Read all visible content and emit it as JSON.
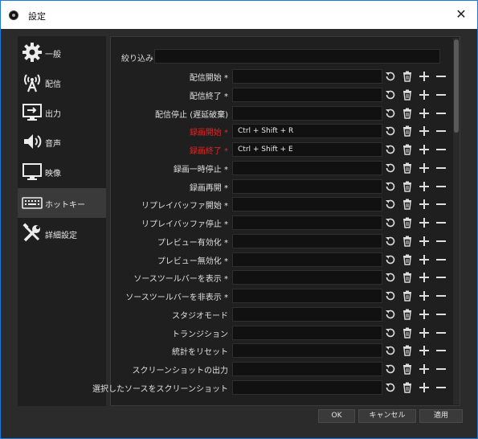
{
  "window": {
    "title": "設定",
    "close_glyph": "✕"
  },
  "sidebar": {
    "items": [
      {
        "label": "一般",
        "icon": "gear-icon",
        "selected": false
      },
      {
        "label": "配信",
        "icon": "broadcast-antenna-icon",
        "selected": false
      },
      {
        "label": "出力",
        "icon": "output-monitor-icon",
        "selected": false
      },
      {
        "label": "音声",
        "icon": "speaker-icon",
        "selected": false
      },
      {
        "label": "映像",
        "icon": "monitor-icon",
        "selected": false
      },
      {
        "label": "ホットキー",
        "icon": "keyboard-icon",
        "selected": true
      },
      {
        "label": "詳細設定",
        "icon": "tools-icon",
        "selected": false
      }
    ]
  },
  "filter": {
    "label": "絞り込み",
    "value": ""
  },
  "hotkeys": [
    {
      "label": "配信開始 *",
      "value": "",
      "highlight": false
    },
    {
      "label": "配信終了 *",
      "value": "",
      "highlight": false
    },
    {
      "label": "配信停止 (遅延破棄)",
      "value": "",
      "highlight": false
    },
    {
      "label": "録画開始 *",
      "value": "Ctrl + Shift + R",
      "highlight": true
    },
    {
      "label": "録画終了 *",
      "value": "Ctrl + Shift + E",
      "highlight": true
    },
    {
      "label": "録画一時停止 *",
      "value": "",
      "highlight": false
    },
    {
      "label": "録画再開 *",
      "value": "",
      "highlight": false
    },
    {
      "label": "リプレイバッファ開始 *",
      "value": "",
      "highlight": false
    },
    {
      "label": "リプレイバッファ停止 *",
      "value": "",
      "highlight": false
    },
    {
      "label": "プレビュー有効化 *",
      "value": "",
      "highlight": false
    },
    {
      "label": "プレビュー無効化 *",
      "value": "",
      "highlight": false
    },
    {
      "label": "ソースツールバーを表示 *",
      "value": "",
      "highlight": false
    },
    {
      "label": "ソースツールバーを非表示 *",
      "value": "",
      "highlight": false
    },
    {
      "label": "スタジオモード",
      "value": "",
      "highlight": false
    },
    {
      "label": "トランジション",
      "value": "",
      "highlight": false
    },
    {
      "label": "統計をリセット",
      "value": "",
      "highlight": false
    },
    {
      "label": "スクリーンショットの出力",
      "value": "",
      "highlight": false
    },
    {
      "label": "選択したソースをスクリーンショット",
      "value": "",
      "highlight": false
    }
  ],
  "footer": {
    "ok_label": "OK",
    "cancel_label": "キャンセル",
    "apply_label": "適用"
  },
  "colors": {
    "accent": "#1e7ad8",
    "highlight_text": "#e32626",
    "panel_bg": "#1f1f1f",
    "window_bg": "#2b2b2b"
  }
}
